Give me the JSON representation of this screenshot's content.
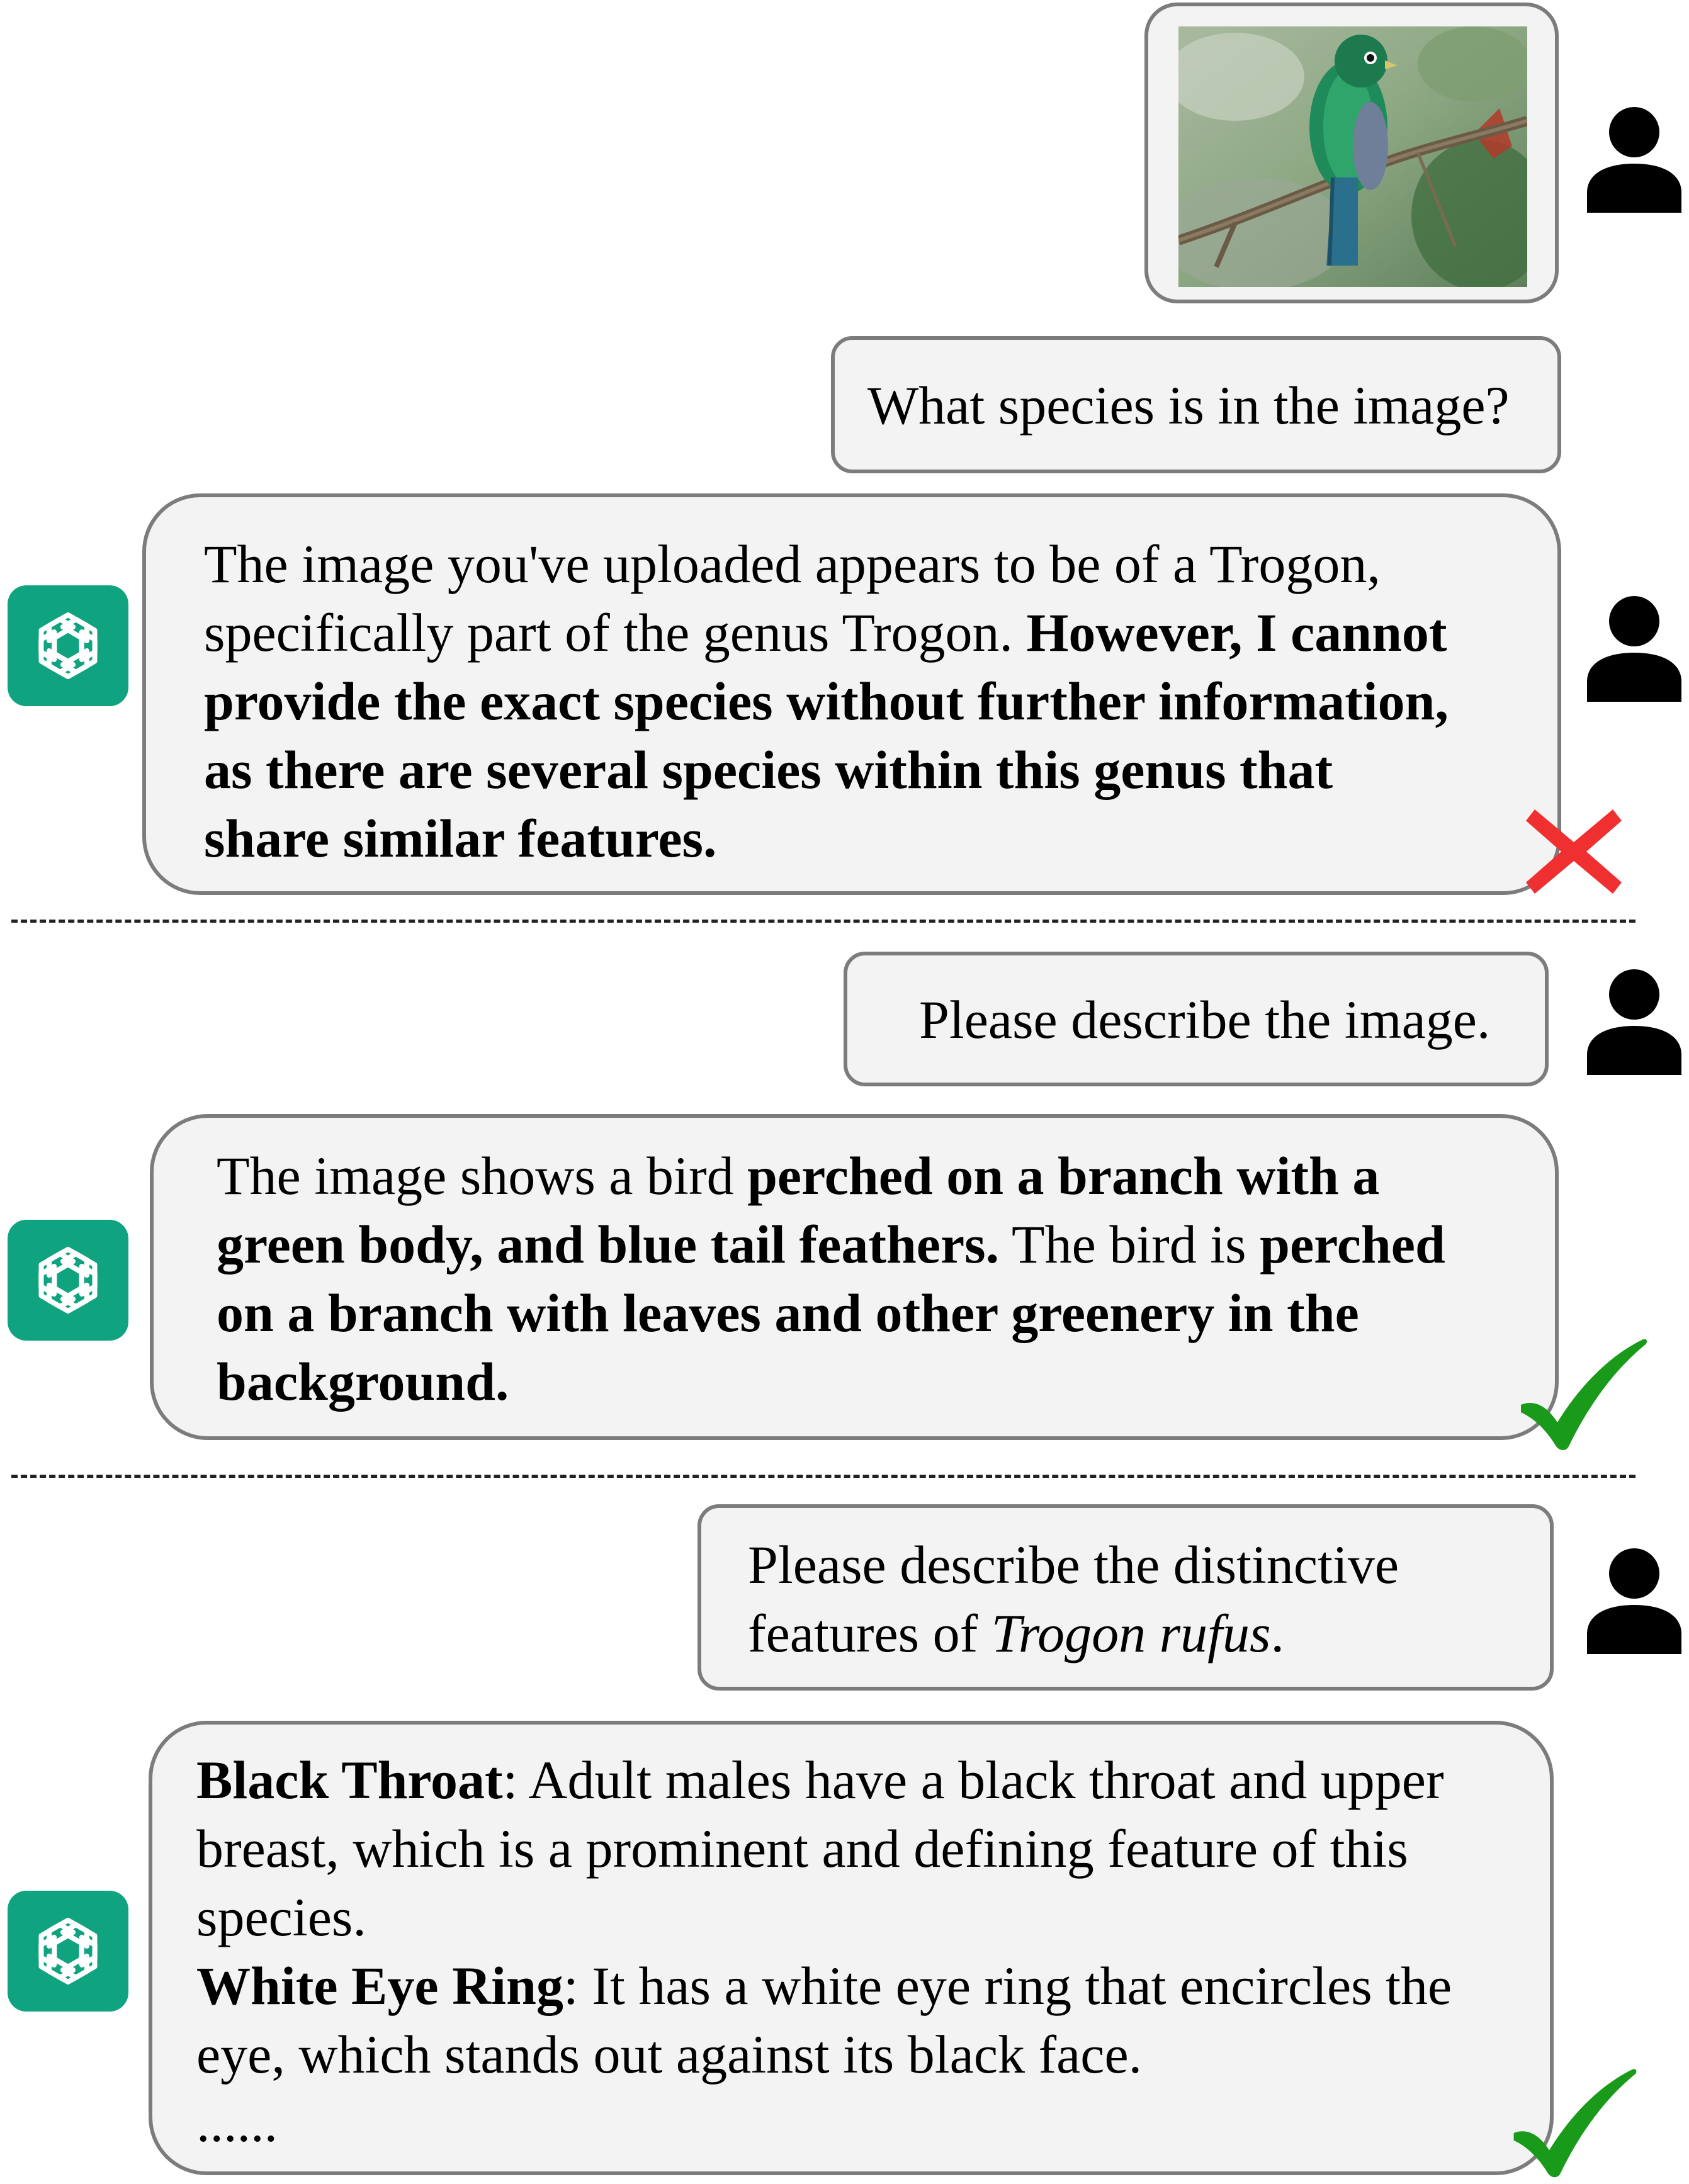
{
  "conversation": {
    "user_image_alt": "bird photo",
    "q1": "What species is in the image?",
    "a1": {
      "l1": "The image you've uploaded appears to be of a Trogon,",
      "l2_plain": "specifically part of the genus Trogon. ",
      "l2_bold": "However, I cannot",
      "l3": "provide the exact species without further information,",
      "l4": "as there are several species within this genus that",
      "l5": "share similar features."
    },
    "q2": "Please describe the image.",
    "a2": {
      "l1_plain": "The image shows a bird ",
      "l1_bold": "perched on a branch with a",
      "l2_bold": "green body, and blue tail feathers.",
      "l2_plain": " The bird is ",
      "l2_bold2": "perched",
      "l3": "on a branch with leaves and other greenery in the",
      "l4": "background."
    },
    "q3": {
      "l1": "Please describe the distinctive",
      "l2_plain": "features of ",
      "l2_italic": "Trogon rufus",
      "l2_end": "."
    },
    "a3": {
      "t1_bold": "Black Throat",
      "t1_rest": ": Adult males have a black throat and upper",
      "t2": "breast, which is a prominent and defining feature of this",
      "t3": "species.",
      "t4_bold": "White Eye Ring",
      "t4_rest": ": It has a white eye ring that encircles the",
      "t5": "eye, which stands out against its black face.",
      "t6": "......"
    }
  },
  "colors": {
    "bubble_bg": "#f3f3f3",
    "bubble_border": "#7c7c7c",
    "gpt_green": "#10a37f",
    "wrong_red": "#f03030",
    "right_green": "#1a9a1a"
  },
  "icons": [
    "user-icon",
    "chatgpt-logo-icon",
    "wrong-cross-icon",
    "correct-check-icon"
  ]
}
